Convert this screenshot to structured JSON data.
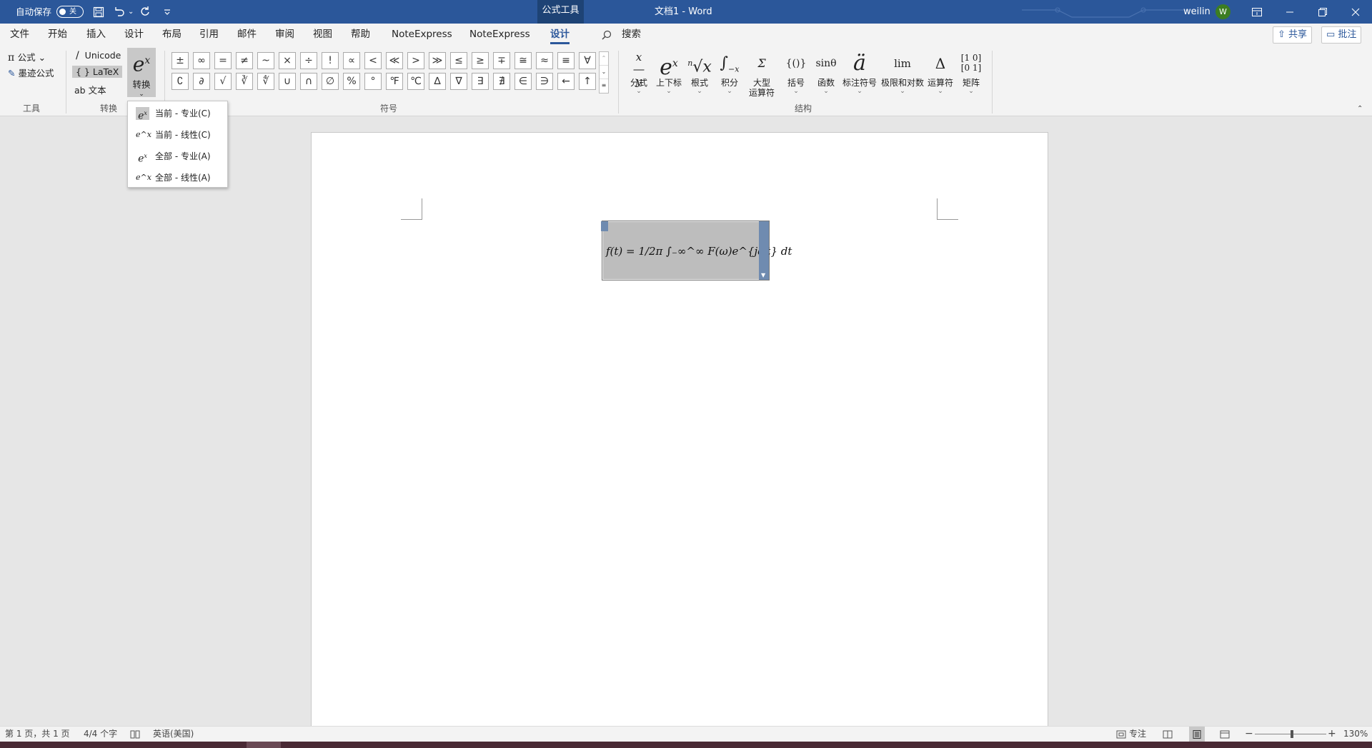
{
  "titlebar": {
    "autosave_label": "自动保存",
    "autosave_state": "关",
    "context_tab": "公式工具",
    "doc_title": "文档1  -  Word",
    "user_name": "weilin",
    "avatar_initial": "W",
    "undo_caret": "⌄"
  },
  "menu": {
    "items": [
      "文件",
      "开始",
      "插入",
      "设计",
      "布局",
      "引用",
      "邮件",
      "审阅",
      "视图",
      "帮助",
      "NoteExpress",
      "NoteExpress",
      "设计"
    ],
    "search": "搜索",
    "share": "共享",
    "comment": "批注"
  },
  "ribbon": {
    "tools": {
      "equation": "公式",
      "ink_equation": "墨迹公式",
      "label": "工具"
    },
    "convert": {
      "unicode": "Unicode",
      "latex": "LaTeX",
      "text": "文本",
      "convert_btn": "转换",
      "label": "转换"
    },
    "symbols": {
      "row1": [
        "±",
        "∞",
        "=",
        "≠",
        "~",
        "×",
        "÷",
        "!",
        "∝",
        "<",
        "≪",
        ">",
        "≫",
        "≤",
        "≥",
        "∓",
        "≅",
        "≈",
        "≡",
        "∀"
      ],
      "row2": [
        "∁",
        "∂",
        "√",
        "∛",
        "∜",
        "∪",
        "∩",
        "∅",
        "%",
        "°",
        "℉",
        "℃",
        "∆",
        "∇",
        "∃",
        "∄",
        "∈",
        "∋",
        "←",
        "↑"
      ],
      "label": "符号"
    },
    "structures": {
      "items": [
        "分式",
        "上下标",
        "根式",
        "积分",
        "大型\n运算符",
        "括号",
        "函数",
        "标注符号",
        "极限和对数",
        "运算符",
        "矩阵"
      ],
      "label": "结构"
    }
  },
  "dropdown": {
    "items": [
      "当前 - 专业(C)",
      "当前 - 线性(C)",
      "全部 - 专业(A)",
      "全部 - 线性(A)"
    ]
  },
  "document": {
    "equation": "f(t) = 1/2π ∫₋∞^∞ F(ω)e^{jωt} dt"
  },
  "statusbar": {
    "page": "第 1 页，共 1 页",
    "words": "4/4 个字",
    "language": "英语(美国)",
    "focus": "专注",
    "zoom": "130%"
  }
}
